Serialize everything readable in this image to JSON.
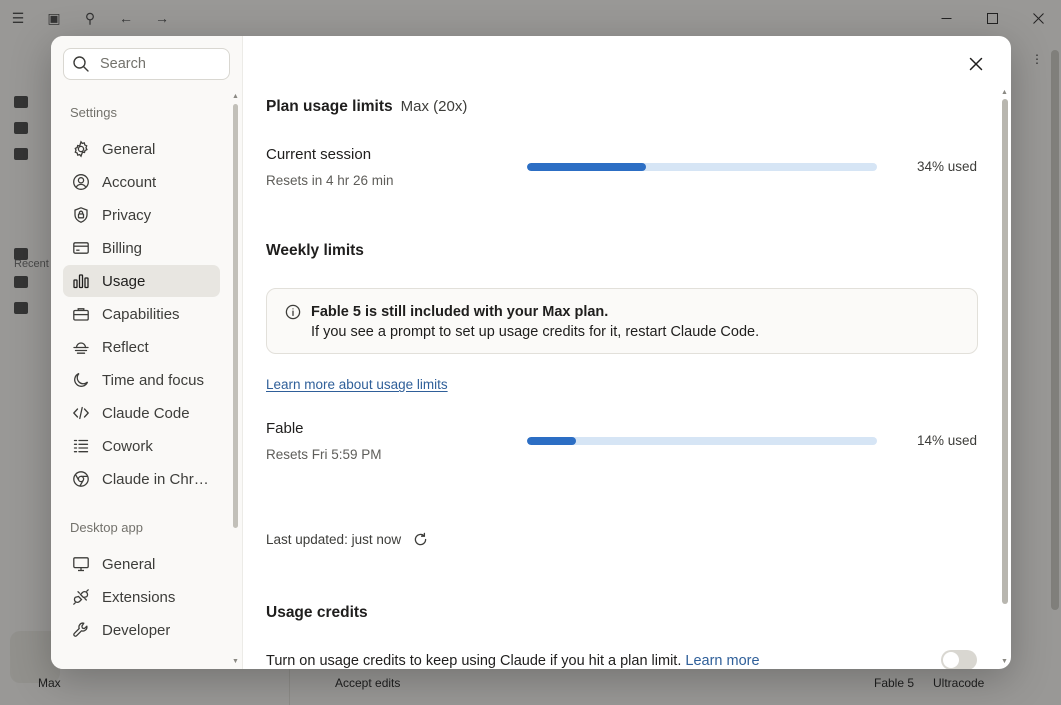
{
  "background": {
    "section_label": "Recent",
    "bottom_bar": {
      "user": "Max",
      "accept_edits": "Accept edits",
      "model": "Fable 5",
      "mode": "Ultracode"
    }
  },
  "settings": {
    "search": {
      "placeholder": "Search"
    },
    "sidebar": {
      "settings_heading": "Settings",
      "items": [
        {
          "label": "General",
          "icon": "gear-icon"
        },
        {
          "label": "Account",
          "icon": "user-circle-icon"
        },
        {
          "label": "Privacy",
          "icon": "shield-lock-icon"
        },
        {
          "label": "Billing",
          "icon": "credit-card-icon"
        },
        {
          "label": "Usage",
          "icon": "bar-chart-icon",
          "active": true
        },
        {
          "label": "Capabilities",
          "icon": "toolbox-icon"
        },
        {
          "label": "Reflect",
          "icon": "sunset-icon"
        },
        {
          "label": "Time and focus",
          "icon": "moon-icon"
        },
        {
          "label": "Claude Code",
          "icon": "code-icon"
        },
        {
          "label": "Cowork",
          "icon": "checklist-icon"
        },
        {
          "label": "Claude in Chr…",
          "icon": "globe-icon"
        }
      ],
      "desktop_heading": "Desktop app",
      "desktop_items": [
        {
          "label": "General",
          "icon": "monitor-icon"
        },
        {
          "label": "Extensions",
          "icon": "plug-icon"
        },
        {
          "label": "Developer",
          "icon": "wrench-icon"
        }
      ]
    },
    "usage": {
      "plan_heading": "Plan usage limits",
      "plan_name": "Max (20x)",
      "current_session": {
        "title": "Current session",
        "resets": "Resets in 4 hr 26 min",
        "percent": 34,
        "percent_label": "34% used"
      },
      "weekly_heading": "Weekly limits",
      "notice": {
        "title": "Fable 5 is still included with your Max plan.",
        "body": "If you see a prompt to set up usage credits for it, restart Claude Code."
      },
      "learn_more_limits": "Learn more about usage limits",
      "fable": {
        "title": "Fable",
        "resets": "Resets Fri 5:59 PM",
        "percent": 14,
        "percent_label": "14% used"
      },
      "last_updated": "Last updated: just now",
      "credits_heading": "Usage credits",
      "credits_text": "Turn on usage credits to keep using Claude if you hit a plan limit.",
      "credits_learn_more": "Learn more",
      "credits_enabled": false
    }
  },
  "colors": {
    "accent_blue": "#2c6ec4",
    "bar_track": "#d6e5f5",
    "link": "#2f5f99",
    "active_nav_bg": "#e8e6e1"
  }
}
